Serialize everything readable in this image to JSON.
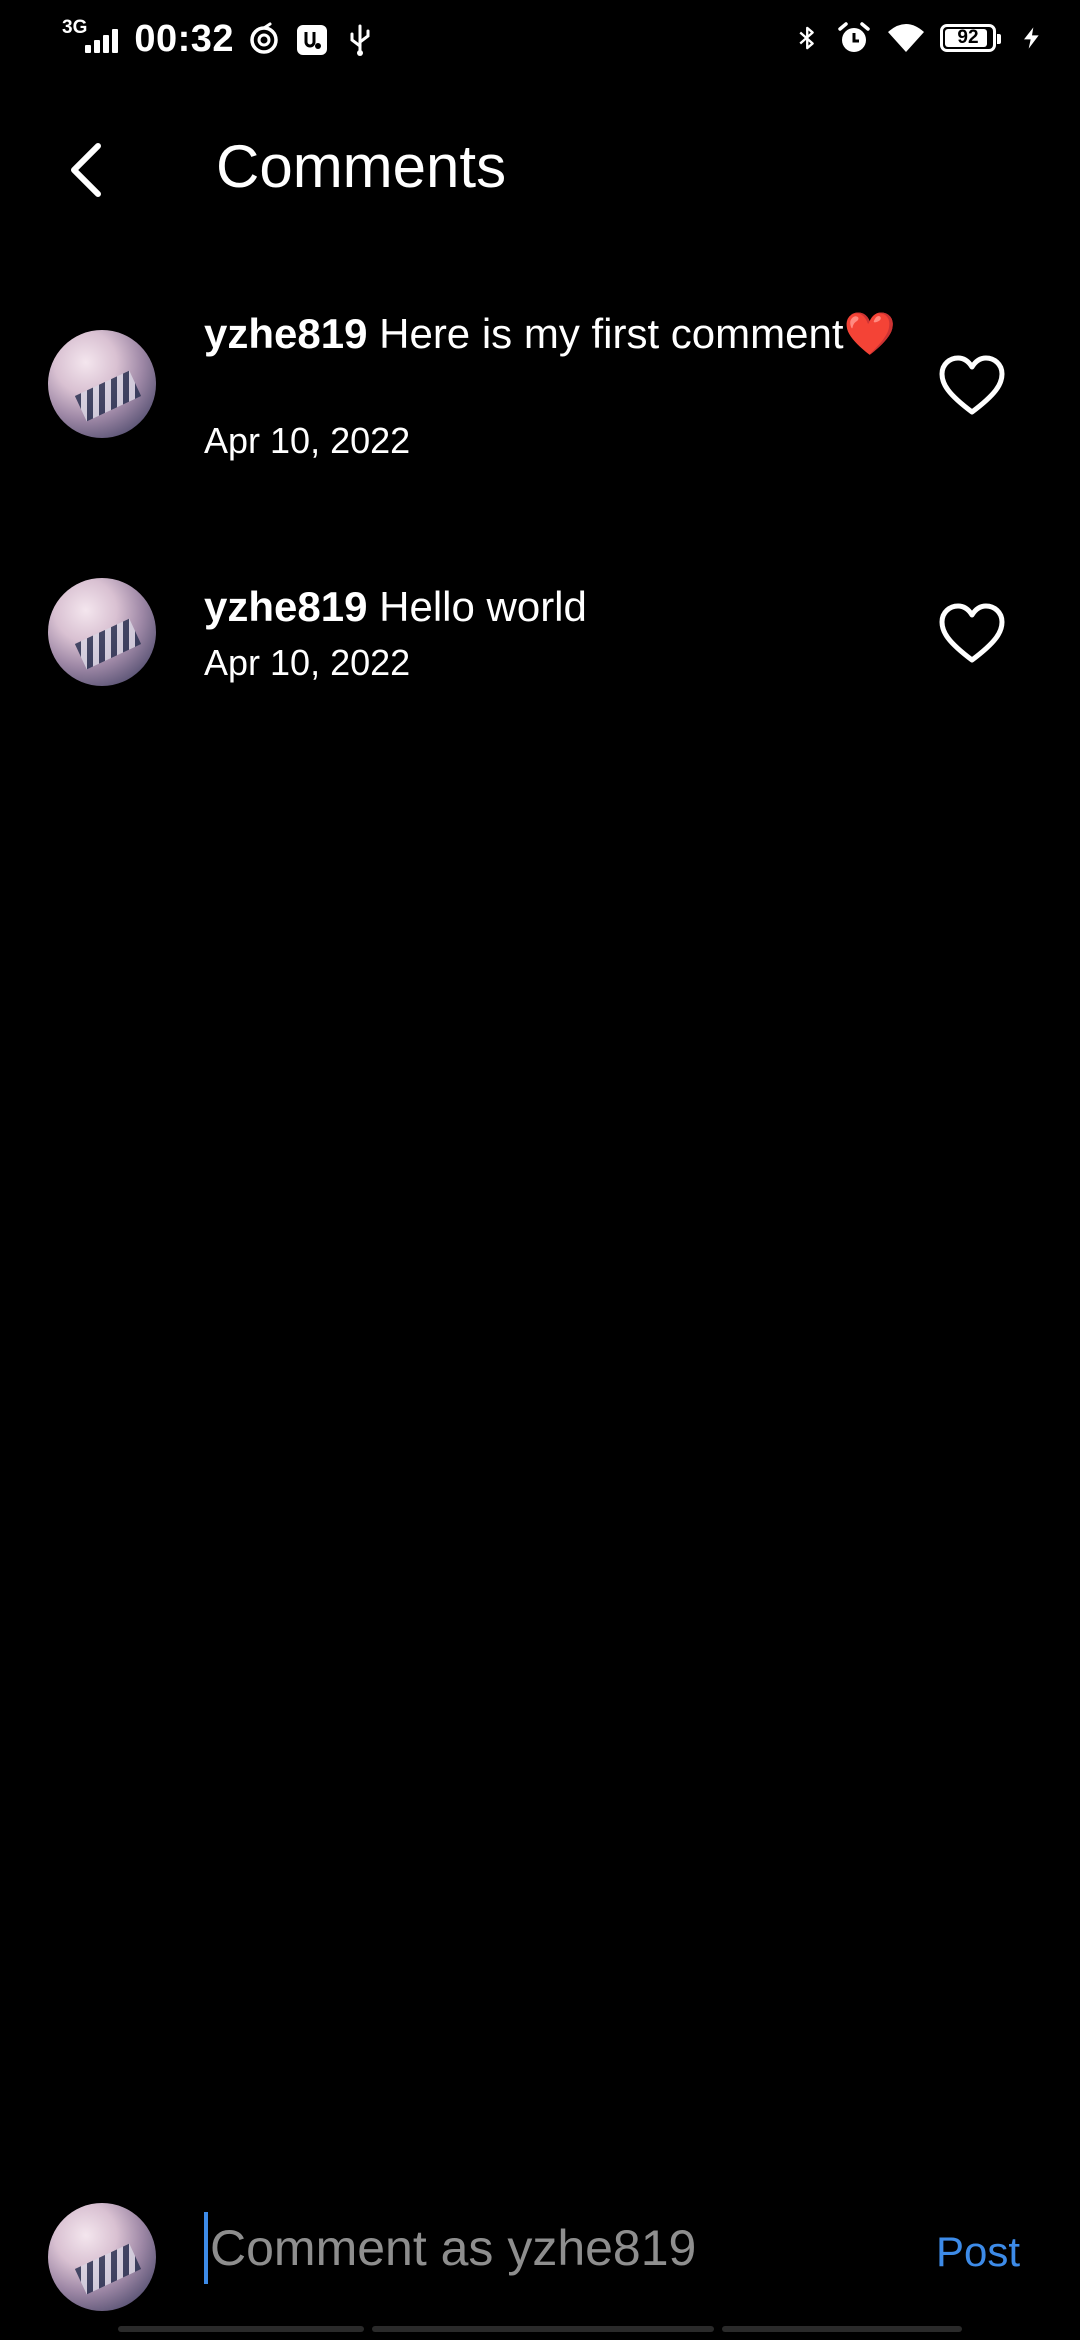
{
  "status_bar": {
    "network": "3G",
    "time": "00:32",
    "battery": "92",
    "battery_level": 0.92
  },
  "header": {
    "title": "Comments"
  },
  "comments": [
    {
      "username": "yzhe819",
      "text": "Here is my first comment❤️",
      "date": "Apr 10, 2022"
    },
    {
      "username": "yzhe819",
      "text": "Hello world",
      "date": "Apr 10, 2022"
    }
  ],
  "composer": {
    "placeholder": "Comment as yzhe819",
    "post_label": "Post"
  },
  "colors": {
    "background": "#000000",
    "text": "#ffffff",
    "accent": "#3d8be8",
    "placeholder": "#8e8e8e"
  }
}
